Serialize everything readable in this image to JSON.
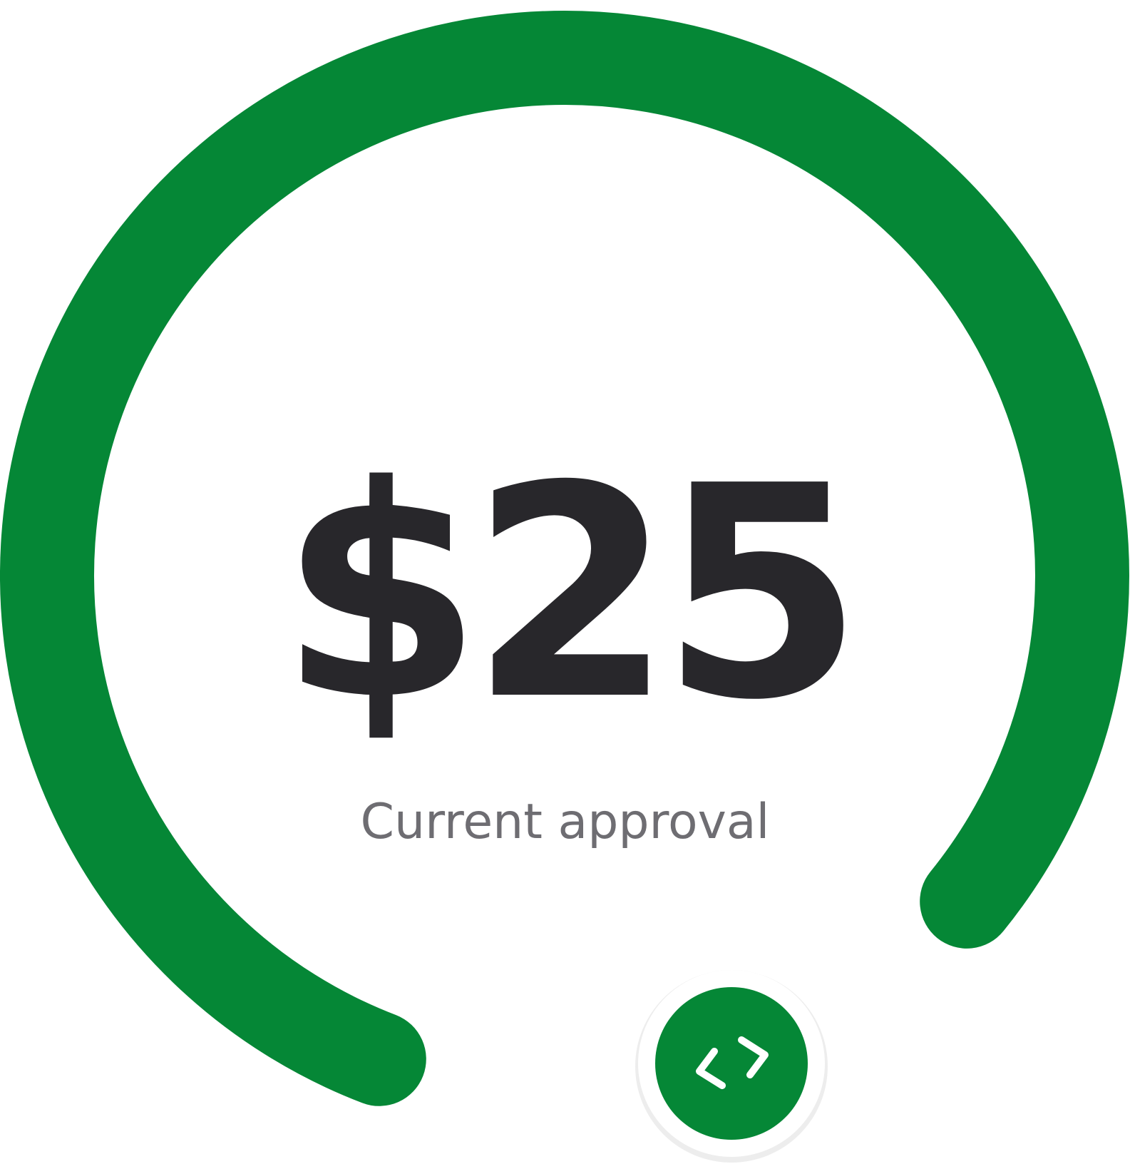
{
  "approval": {
    "amount": "$25",
    "caption": "Current approval",
    "level_percent": 80
  },
  "handle": {
    "icon": "adjust-arrows-icon"
  },
  "colors": {
    "arc": "#058736",
    "handle_fill": "#058736",
    "handle_ring": "#ffffff",
    "amount_text": "#28272b",
    "caption_text": "#6e6d72",
    "background": "#ffffff"
  }
}
